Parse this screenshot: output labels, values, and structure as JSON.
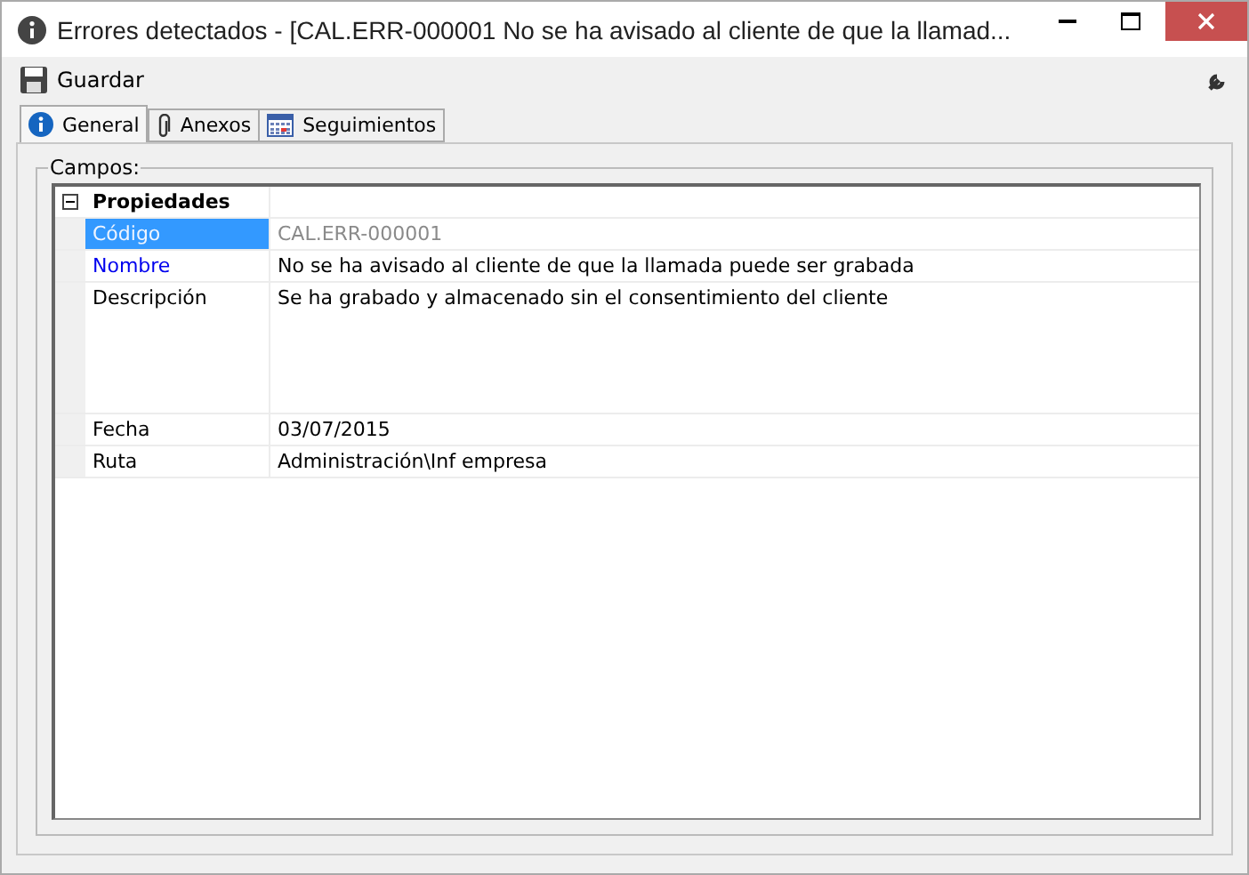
{
  "window": {
    "title": "Errores detectados - [CAL.ERR-000001 No se ha avisado al cliente de que la llamad..."
  },
  "toolbar": {
    "buttons": [
      "Guardar"
    ]
  },
  "tabs": [
    {
      "label": "General",
      "selected": true,
      "kind": "info"
    },
    {
      "label": "Anexos",
      "selected": false,
      "kind": "clip"
    },
    {
      "label": "Seguimientos",
      "selected": false,
      "kind": "calendar"
    }
  ],
  "group": {
    "title": "Campos:"
  },
  "grid": {
    "category": {
      "label": "Propiedades",
      "expanded": true
    },
    "rows": [
      {
        "label": "Código",
        "value": "CAL.ERR-000001",
        "selected": true,
        "readonly": true,
        "required": false,
        "kind": "single"
      },
      {
        "label": "Nombre",
        "value": "No se ha avisado al cliente de que la llamada puede ser grabada",
        "selected": false,
        "readonly": false,
        "required": true,
        "kind": "single"
      },
      {
        "label": "Descripción",
        "value": "Se ha grabado y almacenado sin el consentimiento del cliente",
        "selected": false,
        "readonly": false,
        "required": false,
        "kind": "multiline"
      },
      {
        "label": "Fecha",
        "value": "03/07/2015",
        "selected": false,
        "readonly": false,
        "required": false,
        "kind": "single"
      },
      {
        "label": "Ruta",
        "value": "Administración\\Inf empresa",
        "selected": false,
        "readonly": false,
        "required": false,
        "kind": "single"
      }
    ]
  }
}
